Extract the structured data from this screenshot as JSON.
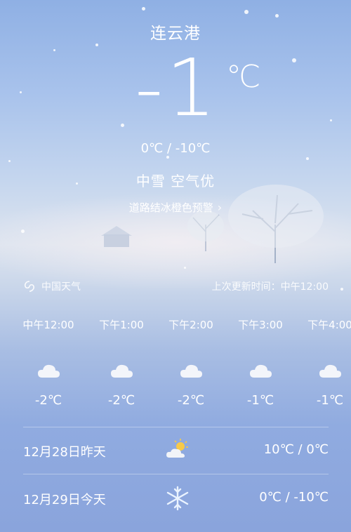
{
  "city": "连云港",
  "current": {
    "temp": "-1",
    "unit": "℃",
    "range": "0℃ / -10℃",
    "condition": "中雪  空气优",
    "alert": "道路结冰橙色预警"
  },
  "source": {
    "name": "中国天气",
    "updated": "上次更新时间：中午12:00"
  },
  "hourly": [
    {
      "time": "中午12:00",
      "icon": "cloud-icon",
      "temp": "-2℃"
    },
    {
      "time": "下午1:00",
      "icon": "cloud-icon",
      "temp": "-2℃"
    },
    {
      "time": "下午2:00",
      "icon": "cloud-icon",
      "temp": "-2℃"
    },
    {
      "time": "下午3:00",
      "icon": "cloud-icon",
      "temp": "-1℃"
    },
    {
      "time": "下午4:00",
      "icon": "cloud-icon",
      "temp": "-1℃"
    }
  ],
  "daily": [
    {
      "date": "12月28日昨天",
      "icon": "partly-sunny-icon",
      "range": "10℃ / 0℃"
    },
    {
      "date": "12月29日今天",
      "icon": "snowflake-icon",
      "range": "0℃ / -10℃"
    }
  ]
}
